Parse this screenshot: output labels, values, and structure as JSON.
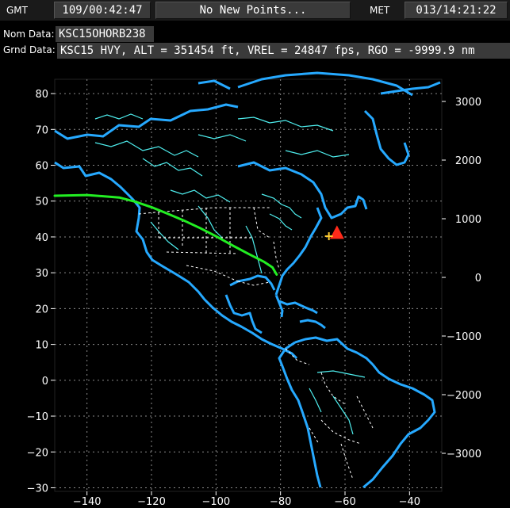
{
  "header": {
    "gmt_label": "GMT",
    "gmt_value": "109/00:42:47",
    "status": "No New Points...",
    "met_label": "MET",
    "met_value": "013/14:21:22"
  },
  "info": {
    "nom_label": "Nom Data:",
    "nom_value": "KSC15OHORB238",
    "grnd_label": "Grnd Data:",
    "grnd_value": "KSC15 HVY, ALT = 351454 ft, VREL = 24847 fps, RGO = -9999.9 nm"
  },
  "chart_data": {
    "type": "map-ground-track",
    "x_ticks": [
      "−140",
      "−120",
      "−100",
      "−80",
      "−60",
      "−40"
    ],
    "x_tick_values": [
      -140,
      -120,
      -100,
      -80,
      -60,
      -40
    ],
    "y_ticks": [
      "80",
      "70",
      "60",
      "50",
      "40",
      "30",
      "20",
      "10",
      "0",
      "−10",
      "−20",
      "−30"
    ],
    "y_tick_values": [
      80,
      70,
      60,
      50,
      40,
      30,
      20,
      10,
      0,
      -10,
      -20,
      -30
    ],
    "right_ticks": [
      "3000",
      "2000",
      "1000",
      "0",
      "−1000",
      "−2000",
      "−3000"
    ],
    "right_tick_values": [
      3000,
      2000,
      1000,
      0,
      -1000,
      -2000,
      -3000
    ],
    "xlim": [
      -150,
      -30
    ],
    "ylim": [
      -31,
      84
    ],
    "ground_track": [
      [
        -150,
        51.5
      ],
      [
        -140,
        51.7
      ],
      [
        -130,
        51.0
      ],
      [
        -125,
        49.8
      ],
      [
        -120,
        48.3
      ],
      [
        -115,
        46.5
      ],
      [
        -110,
        44.6
      ],
      [
        -105,
        42.5
      ],
      [
        -100,
        40.2
      ],
      [
        -95,
        37.7
      ],
      [
        -90,
        35.3
      ],
      [
        -85,
        33.0
      ],
      [
        -82.5,
        31.5
      ],
      [
        -81.2,
        29.5
      ]
    ],
    "vehicle_position": [
      -62.5,
      41.0
    ],
    "nominal_marker": [
      -65.0,
      40.2
    ],
    "colors": {
      "coastline": "#26a9ff",
      "rivers": "#4ff0f0",
      "borders": "#ffffff",
      "ground_track": "#22ee22",
      "vehicle": "#ff2a1a",
      "nominal": "#ffcc33"
    }
  }
}
